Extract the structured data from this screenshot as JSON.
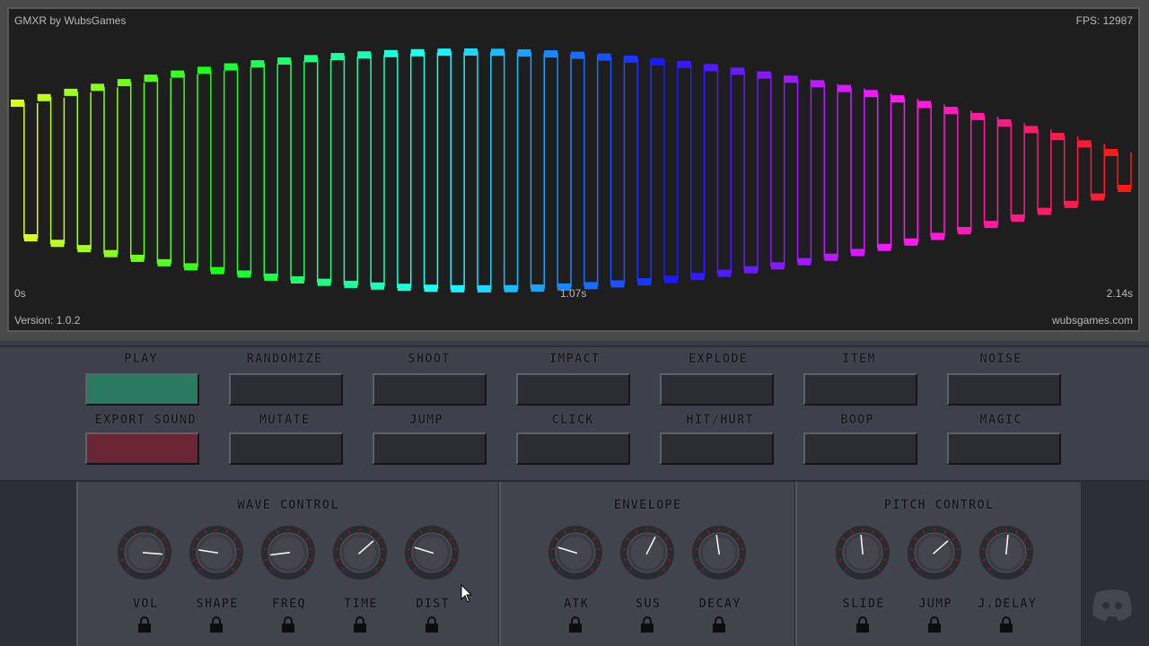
{
  "scope": {
    "title": "GMXR by WubsGames",
    "fps": "FPS: 12987",
    "time_start": "0s",
    "time_mid": "1.07s",
    "time_end": "2.14s",
    "version": "Version: 1.0.2",
    "website": "wubsgames.com"
  },
  "buttons": {
    "row1": [
      {
        "label": "Play",
        "style": "play"
      },
      {
        "label": "Randomize",
        "style": "normal"
      },
      {
        "label": "Shoot",
        "style": "normal"
      },
      {
        "label": "Impact",
        "style": "normal"
      },
      {
        "label": "Explode",
        "style": "normal"
      },
      {
        "label": "Item",
        "style": "normal"
      },
      {
        "label": "Noise",
        "style": "normal"
      }
    ],
    "row2": [
      {
        "label": "Export Sound",
        "style": "export"
      },
      {
        "label": "Mutate",
        "style": "normal"
      },
      {
        "label": "Jump",
        "style": "normal"
      },
      {
        "label": "Click",
        "style": "normal"
      },
      {
        "label": "Hit/Hurt",
        "style": "normal"
      },
      {
        "label": "Boop",
        "style": "normal"
      },
      {
        "label": "Magic",
        "style": "normal"
      }
    ]
  },
  "panels": [
    {
      "title": "Wave Control",
      "knobs": [
        {
          "label": "VOL",
          "value": 0.85
        },
        {
          "label": "Shape",
          "value": 0.2
        },
        {
          "label": "Freq",
          "value": 0.14
        },
        {
          "label": "Time",
          "value": 0.68
        },
        {
          "label": "Dist",
          "value": 0.23
        }
      ]
    },
    {
      "title": "Envelope",
      "knobs": [
        {
          "label": "Atk",
          "value": 0.23
        },
        {
          "label": "Sus",
          "value": 0.6
        },
        {
          "label": "Decay",
          "value": 0.47
        }
      ]
    },
    {
      "title": "Pitch Control",
      "knobs": [
        {
          "label": "Slide",
          "value": 0.48
        },
        {
          "label": "Jump",
          "value": 0.68
        },
        {
          "label": "J.Delay",
          "value": 0.52
        }
      ]
    }
  ],
  "colors": {
    "play": "#2a7a62",
    "export": "#6b2634",
    "panel": "#41434d",
    "scope_bg": "#1e1e1e",
    "knob_pointer": "#ffffff",
    "lock": "#0d0d10"
  },
  "icons": {
    "lock": "lock-icon",
    "discord": "discord-icon",
    "cursor": "mouse-cursor-icon"
  }
}
